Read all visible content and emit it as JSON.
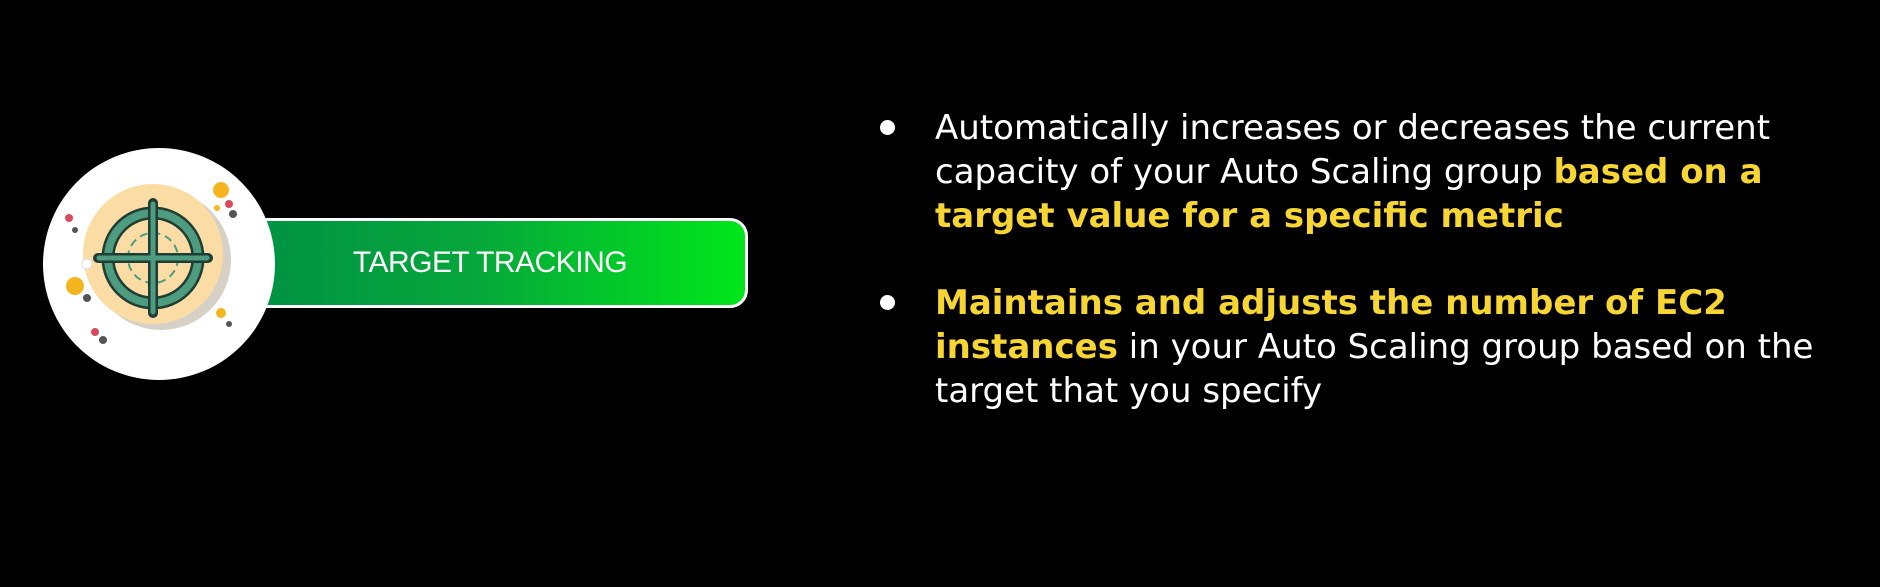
{
  "badge": {
    "label": "TARGET TRACKING",
    "icon": "crosshair-target-icon"
  },
  "bullets": [
    {
      "parts": [
        {
          "text": "Automatically increases or decreases the current capacity of your Auto Scaling group ",
          "highlight": false
        },
        {
          "text": "based on a target value for a specific metric",
          "highlight": true
        }
      ]
    },
    {
      "parts": [
        {
          "text": "Maintains and adjusts the number of EC2 instances",
          "highlight": true
        },
        {
          "text": " in your Auto Scaling group based on the target that you specify",
          "highlight": false
        }
      ]
    }
  ],
  "colors": {
    "background": "#000000",
    "text": "#ffffff",
    "highlight": "#f7d633",
    "badge_green_start": "#009143",
    "badge_green_end": "#00e61a",
    "icon_circle": "#fbdca4",
    "icon_ring": "#4e9c80"
  }
}
